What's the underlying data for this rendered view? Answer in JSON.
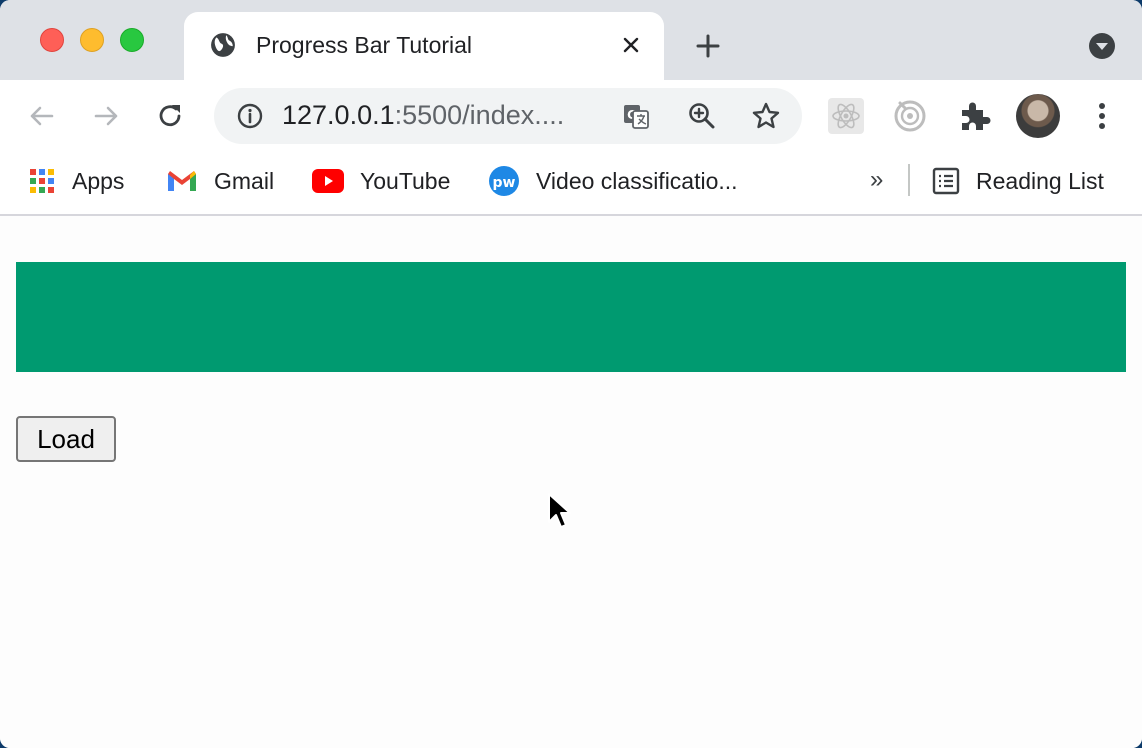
{
  "browser": {
    "tab": {
      "title": "Progress Bar Tutorial"
    },
    "address_bar": {
      "host": "127.0.0.1",
      "rest": ":5500/index...."
    },
    "bookmarks": [
      {
        "label": "Apps",
        "icon": "apps-grid-icon"
      },
      {
        "label": "Gmail",
        "icon": "gmail-icon"
      },
      {
        "label": "YouTube",
        "icon": "youtube-icon"
      },
      {
        "label": "Video classificatio...",
        "icon": "pw-icon"
      }
    ],
    "overflow_label": "»",
    "reading_list": {
      "label": "Reading List"
    }
  },
  "page": {
    "progress": {
      "fraction": 1.0,
      "color": "#009a70"
    },
    "load_button": {
      "label": "Load"
    }
  }
}
